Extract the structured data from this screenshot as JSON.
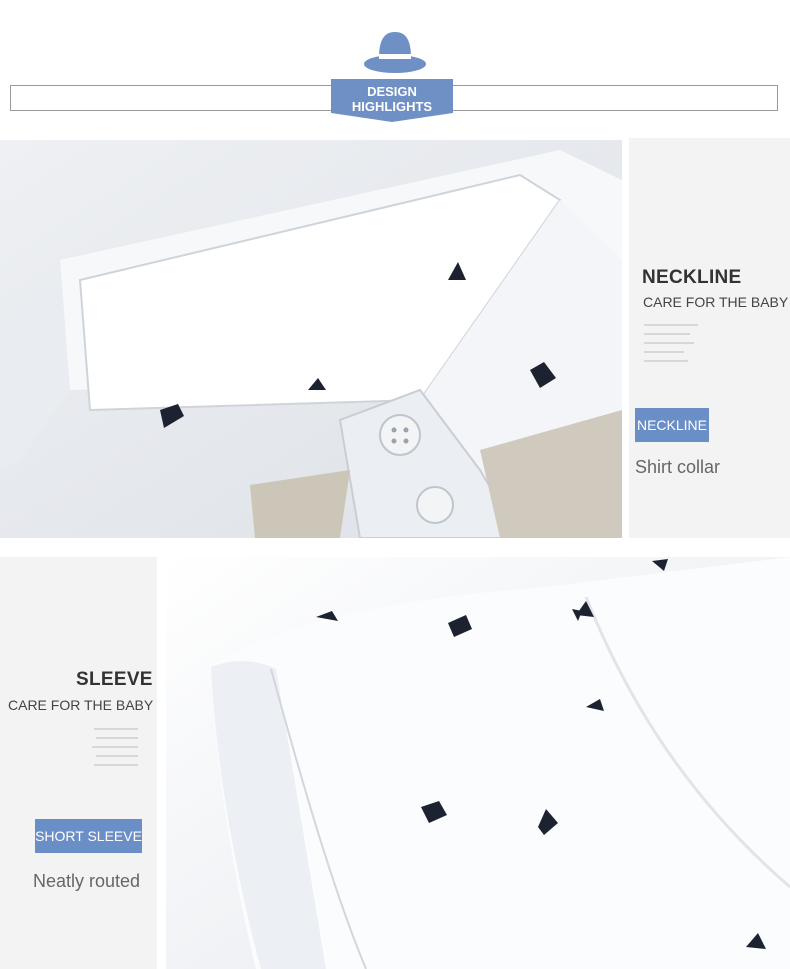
{
  "header": {
    "badge_line1": "DESIGN",
    "badge_line2": "HIGHLIGHTS",
    "icon": "hat-icon",
    "accent_color": "#6f90c4"
  },
  "neckline": {
    "title": "NECKLINE",
    "subtitle": "CARE FOR THE BABY",
    "tag": "NECKLINE",
    "description": "Shirt collar",
    "photo_icon": "shirt-collar-photo"
  },
  "sleeve": {
    "title": "SLEEVE",
    "subtitle": "CARE FOR THE BABY",
    "tag": "SHORT SLEEVE",
    "description": "Neatly routed",
    "photo_icon": "shirt-sleeve-photo"
  }
}
